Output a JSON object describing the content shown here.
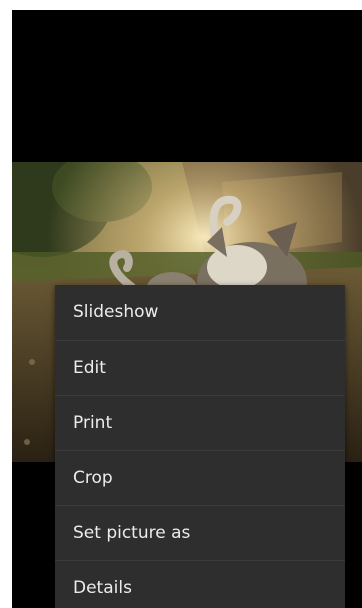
{
  "context_menu": {
    "items": [
      {
        "label": "Slideshow"
      },
      {
        "label": "Edit"
      },
      {
        "label": "Print"
      },
      {
        "label": "Crop"
      },
      {
        "label": "Set picture as"
      },
      {
        "label": "Details"
      }
    ]
  },
  "colors": {
    "viewer_background": "#000000",
    "menu_background": "#2e2e2e",
    "menu_text": "#ececec",
    "menu_divider": "#3b3b3b"
  }
}
